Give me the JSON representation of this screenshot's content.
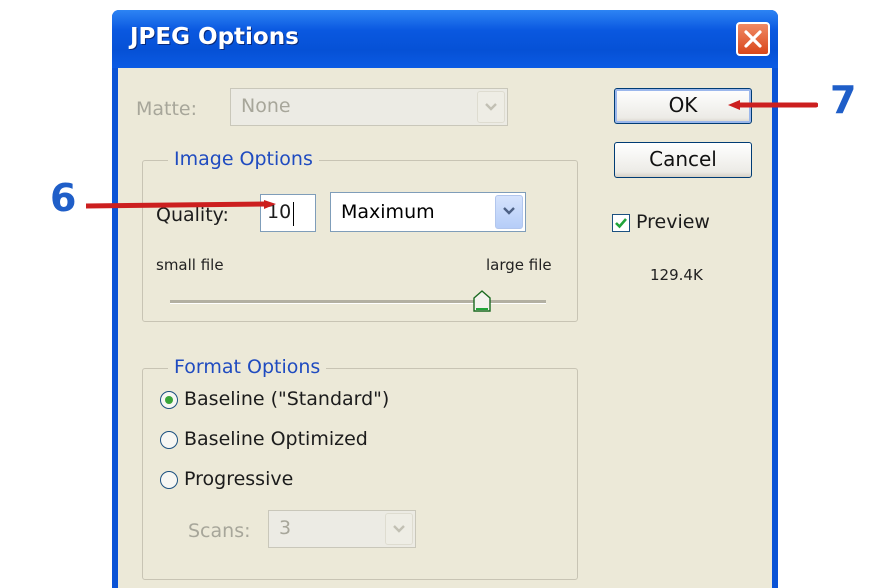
{
  "window": {
    "title": "JPEG Options"
  },
  "matte": {
    "label": "Matte:",
    "value": "None"
  },
  "image_options": {
    "legend": "Image Options",
    "quality_label": "Quality:",
    "quality_value": "10",
    "quality_preset": "Maximum",
    "small_file_label": "small file",
    "large_file_label": "large file",
    "slider_fraction": 0.83
  },
  "format_options": {
    "legend": "Format Options",
    "options": [
      {
        "label": "Baseline (\"Standard\")",
        "selected": true
      },
      {
        "label": "Baseline Optimized",
        "selected": false
      },
      {
        "label": "Progressive",
        "selected": false
      }
    ],
    "scans_label": "Scans:",
    "scans_value": "3"
  },
  "buttons": {
    "ok": "OK",
    "cancel": "Cancel"
  },
  "preview": {
    "label": "Preview",
    "checked": true,
    "file_size": "129.4K"
  },
  "annotations": {
    "step_quality": "6",
    "step_ok": "7"
  },
  "colors": {
    "accent": "#0a53d6",
    "annotation_arrow": "#cc1f1f",
    "annotation_number": "#1f5ec8"
  }
}
